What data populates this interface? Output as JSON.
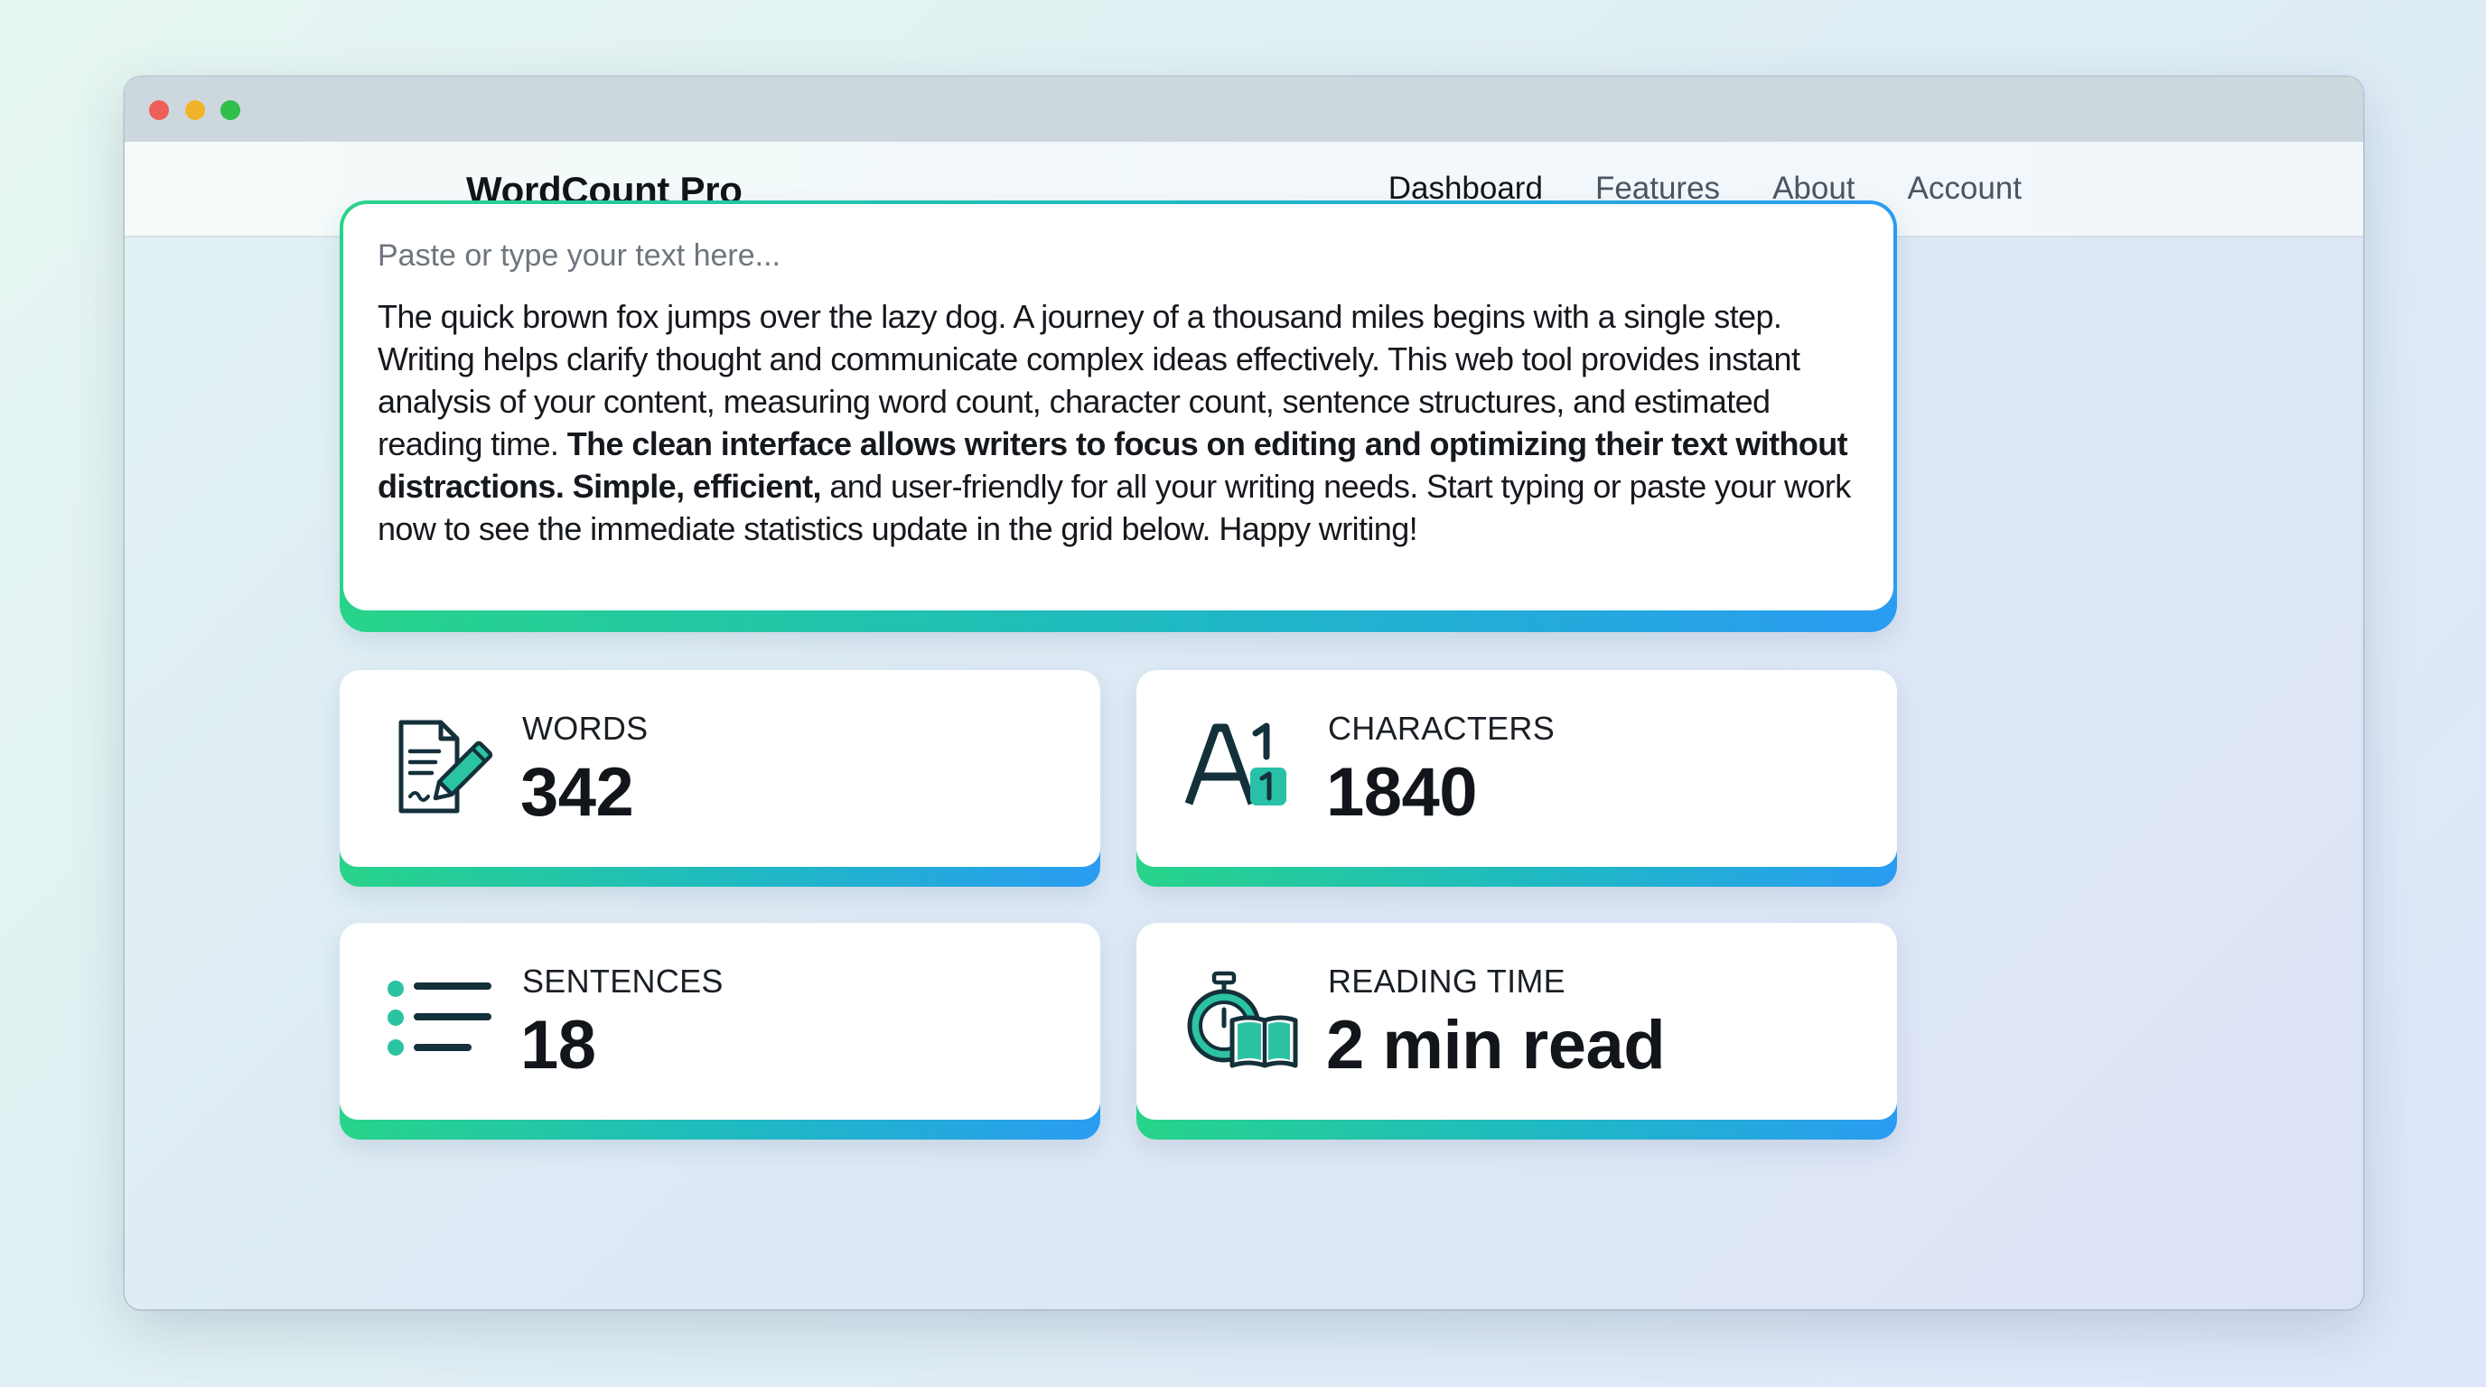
{
  "window": {
    "controls": {
      "close": "close",
      "minimize": "minimize",
      "maximize": "maximize"
    }
  },
  "nav": {
    "brand": "WordCount Pro",
    "links": [
      "Dashboard",
      "Features",
      "About",
      "Account"
    ],
    "active": "Dashboard"
  },
  "editor": {
    "placeholder": "Paste or type your text here...",
    "text_part1": "The quick brown fox jumps over the lazy dog. A journey of a thousand miles begins with a single step. Writing helps clarify thought and communicate complex ideas effectively. This web tool provides instant analysis of your content, measuring word count, character count, sentence structures, and estimated reading time. ",
    "text_bold": "The clean interface allows writers to focus on editing and optimizing their text without distractions. Simple, efficient,",
    "text_part2": " and user-friendly for all your writing needs. Start typing or paste your work now to see the immediate statistics update in the grid below. Happy writing!"
  },
  "stats": {
    "words": {
      "label": "WORDS",
      "value": "342",
      "icon": "document-pen-icon"
    },
    "characters": {
      "label": "CHARACTERS",
      "value": "1840",
      "icon": "letter-a-one-icon"
    },
    "sentences": {
      "label": "SENTENCES",
      "value": "18",
      "icon": "list-icon"
    },
    "reading_time": {
      "label": "READING TIME",
      "value": "2 min read",
      "icon": "stopwatch-book-icon"
    }
  },
  "colors": {
    "accent_green": "#28d48a",
    "accent_teal": "#1fb8c4",
    "accent_blue": "#2a9cf2",
    "icon_dark": "#14303a"
  }
}
